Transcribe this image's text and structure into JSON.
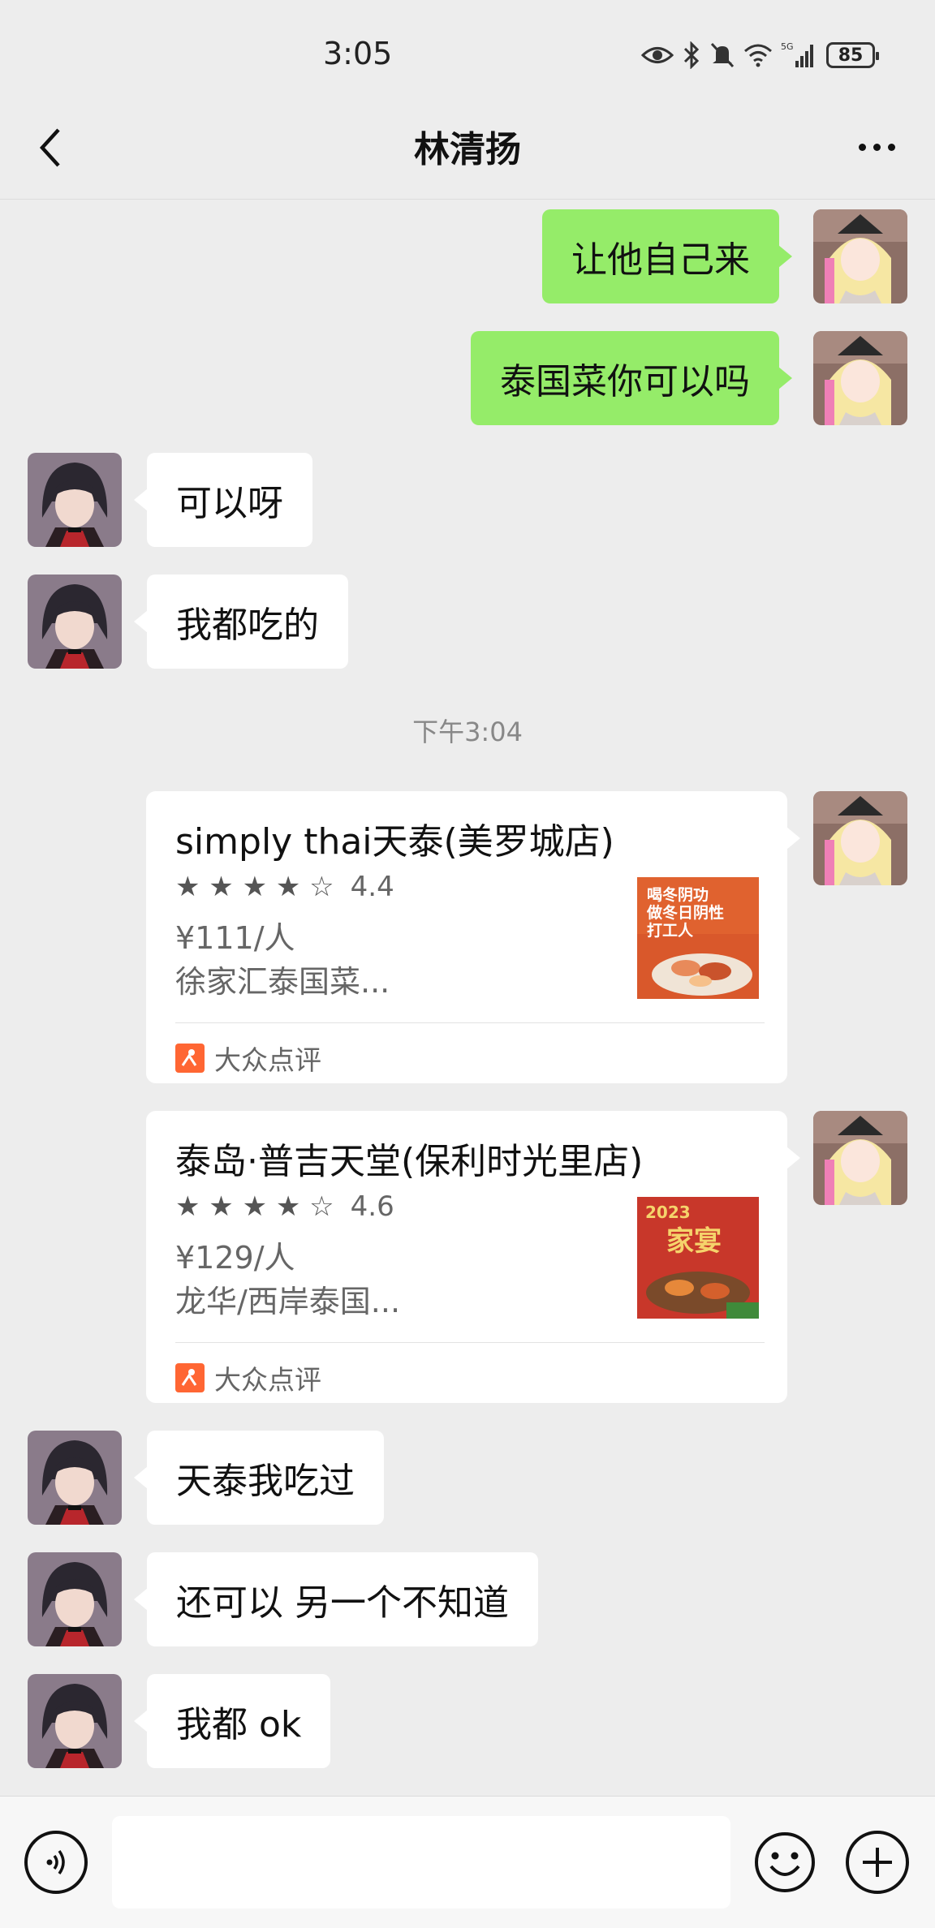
{
  "status_bar": {
    "time": "3:05",
    "battery": "85",
    "icons": [
      "eye-icon",
      "bluetooth-icon",
      "mute-icon",
      "wifi-icon",
      "5g-signal-icon",
      "battery-icon"
    ]
  },
  "header": {
    "title": "林清扬",
    "back_icon": "chevron-left-icon",
    "more_icon": "more-icon"
  },
  "messages": [
    {
      "side": "out",
      "text": "让他自己来"
    },
    {
      "side": "out",
      "text": "泰国菜你可以吗"
    },
    {
      "side": "in",
      "text": "可以呀"
    },
    {
      "side": "in",
      "text": "我都吃的"
    }
  ],
  "timestamp": "下午3:04",
  "cards": [
    {
      "title": "simply thai天泰(美罗城店)",
      "stars": "★ ★ ★ ★ ☆",
      "rating": "4.4",
      "price": "¥111/人",
      "area": "徐家汇泰国菜...",
      "source": "大众点评",
      "thumb_text": "喝冬阴功 做冬日阴性 打工人"
    },
    {
      "title": "泰岛·普吉天堂(保利时光里店)",
      "stars": "★ ★ ★ ★ ☆",
      "rating": "4.6",
      "price": "¥129/人",
      "area": "龙华/西岸泰国...",
      "source": "大众点评",
      "thumb_text": "2023 家宴"
    }
  ],
  "messages_after": [
    {
      "side": "in",
      "text": "天泰我吃过"
    },
    {
      "side": "in",
      "text": "还可以 另一个不知道"
    },
    {
      "side": "in",
      "text": "我都 ok"
    }
  ],
  "input_bar": {
    "placeholder": "",
    "voice_icon": "voice-icon",
    "emoji_icon": "emoji-icon",
    "plus_icon": "plus-icon"
  },
  "colors": {
    "background": "#ededed",
    "outgoing_bubble": "#95ec69",
    "incoming_bubble": "#ffffff",
    "dianping_orange": "#ff6633"
  }
}
